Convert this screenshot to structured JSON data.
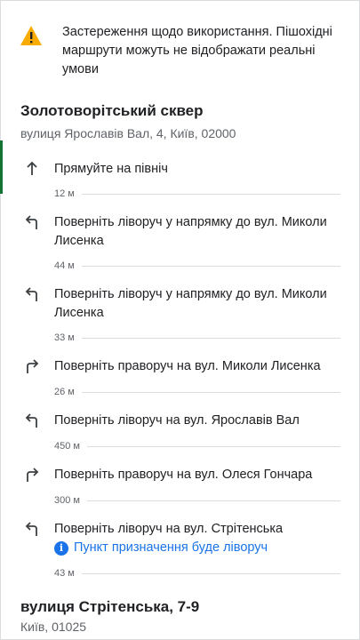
{
  "warning": {
    "icon": "warning-icon",
    "text": "Застереження щодо використання. Пішохідні маршрути можуть не відображати реальні умови"
  },
  "origin": {
    "title": "Золотоворітський сквер",
    "address": "вулиця Ярославів Вал, 4, Київ, 02000"
  },
  "steps": [
    {
      "icon": "arrow-up-icon",
      "instruction": "Прямуйте на північ",
      "distance": "12 м"
    },
    {
      "icon": "turn-left-icon",
      "instruction": "Поверніть ліворуч у напрямку до вул. Миколи Лисенка",
      "distance": "44 м"
    },
    {
      "icon": "turn-left-icon",
      "instruction": "Поверніть ліворуч у напрямку до вул. Миколи Лисенка",
      "distance": "33 м"
    },
    {
      "icon": "turn-right-icon",
      "instruction": "Поверніть праворуч на вул. Миколи Лисенка",
      "distance": "26 м"
    },
    {
      "icon": "turn-left-icon",
      "instruction": "Поверніть ліворуч на вул. Ярославів Вал",
      "distance": "450 м"
    },
    {
      "icon": "turn-right-icon",
      "instruction": "Поверніть праворуч на вул. Олеся Гончара",
      "distance": "300 м"
    },
    {
      "icon": "turn-left-icon",
      "instruction": "Поверніть ліворуч на вул. Стрітенська",
      "note": "Пункт призначення буде ліворуч",
      "distance": "43 м"
    }
  ],
  "destination": {
    "title": "вулиця Стрітенська, 7-9",
    "address": "Київ, 01025"
  },
  "colors": {
    "accent": "#137333",
    "link": "#1a73e8",
    "warning": "#f9ab00"
  }
}
